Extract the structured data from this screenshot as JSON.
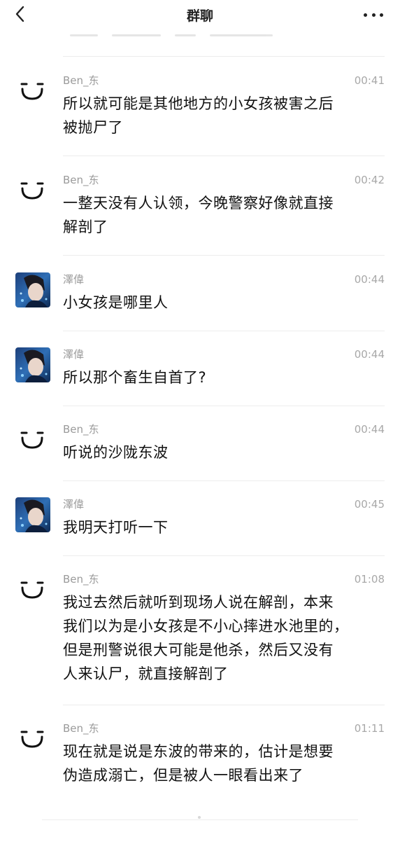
{
  "header": {
    "title": "群聊",
    "back_icon": "chevron-left-icon",
    "more_icon": "more-dots-icon"
  },
  "messages": [
    {
      "sender": "Ben_东",
      "time": "00:41",
      "avatar": "smiley-face-avatar",
      "lines": [
        "所以就可能是其他地方的小女孩被害之后",
        "被抛尸了"
      ]
    },
    {
      "sender": "Ben_东",
      "time": "00:42",
      "avatar": "smiley-face-avatar",
      "lines": [
        "一整天没有人认领，今晚警察好像就直接",
        "解剖了"
      ]
    },
    {
      "sender": "澤偉",
      "time": "00:44",
      "avatar": "photo-avatar",
      "lines": [
        "小女孩是哪里人"
      ]
    },
    {
      "sender": "澤偉",
      "time": "00:44",
      "avatar": "photo-avatar",
      "lines": [
        "所以那个畜生自首了?"
      ]
    },
    {
      "sender": "Ben_东",
      "time": "00:44",
      "avatar": "smiley-face-avatar",
      "lines": [
        "听说的沙陇东波"
      ]
    },
    {
      "sender": "澤偉",
      "time": "00:45",
      "avatar": "photo-avatar",
      "lines": [
        "我明天打听一下"
      ]
    },
    {
      "sender": "Ben_东",
      "time": "01:08",
      "avatar": "smiley-face-avatar",
      "lines": [
        "我过去然后就听到现场人说在解剖，本来",
        "我们以为是小女孩是不小心摔进水池里的，",
        "但是刑警说很大可能是他杀，然后又没有",
        "人来认尸，就直接解剖了"
      ]
    },
    {
      "sender": "Ben_东",
      "time": "01:11",
      "avatar": "smiley-face-avatar",
      "lines": [
        "现在就是说是东波的带来的，估计是想要",
        "伪造成溺亡，但是被人一眼看出来了"
      ]
    }
  ]
}
